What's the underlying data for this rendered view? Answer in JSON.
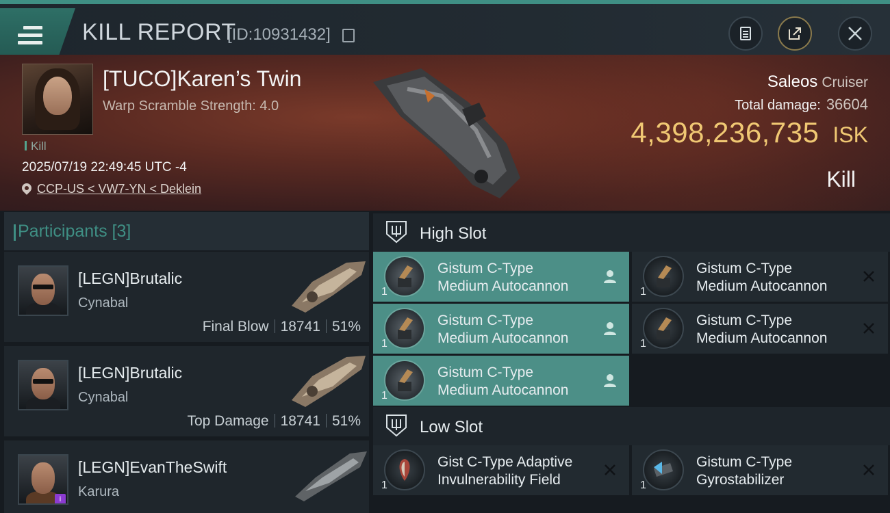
{
  "header": {
    "title": "KILL REPORT",
    "id_text": "[ID:10931432]"
  },
  "victim": {
    "pilot_name": "[TUCO]Karen’s Twin",
    "warp_scramble": "Warp Scramble Strength: 4.0",
    "kill_tag": "Kill",
    "datetime": "2025/07/19 22:49:45 UTC -4",
    "location": "CCP-US < VW7-YN < Deklein",
    "ship_name": "Saleos",
    "ship_class": "Cruiser",
    "total_damage_label": "Total damage:",
    "total_damage": "36604",
    "isk_value": "4,398,236,735",
    "isk_unit": "ISK",
    "result": "Kill"
  },
  "participants": {
    "title": "Participants [3]",
    "items": [
      {
        "name": "[LEGN]Brutalic",
        "ship": "Cynabal",
        "role": "Final Blow",
        "damage": "18741",
        "percent": "51%"
      },
      {
        "name": "[LEGN]Brutalic",
        "ship": "Cynabal",
        "role": "Top Damage",
        "damage": "18741",
        "percent": "51%"
      },
      {
        "name": "[LEGN]EvanTheSwift",
        "ship": "Karura",
        "badge": "i"
      }
    ]
  },
  "high_slot": {
    "title": "High Slot",
    "modules": [
      {
        "line1": "Gistum C-Type",
        "line2": "Medium Autocannon",
        "qty": "1",
        "state": "dropped"
      },
      {
        "line1": "Gistum C-Type",
        "line2": "Medium Autocannon",
        "qty": "1",
        "state": "destroyed"
      },
      {
        "line1": "Gistum C-Type",
        "line2": "Medium Autocannon",
        "qty": "1",
        "state": "dropped"
      },
      {
        "line1": "Gistum C-Type",
        "line2": "Medium Autocannon",
        "qty": "1",
        "state": "destroyed"
      },
      {
        "line1": "Gistum C-Type",
        "line2": "Medium Autocannon",
        "qty": "1",
        "state": "dropped"
      }
    ]
  },
  "low_slot": {
    "title": "Low Slot",
    "modules": [
      {
        "line1": "Gist C-Type Adaptive",
        "line2": "Invulnerability Field",
        "qty": "1",
        "state": "destroyed"
      },
      {
        "line1": "Gistum C-Type",
        "line2": "Gyrostabilizer",
        "qty": "1",
        "state": "destroyed"
      }
    ]
  },
  "icons": {
    "menu": "hamburger-menu-icon",
    "copy": "copy-icon",
    "clipboard": "clipboard-icon",
    "share": "share-icon",
    "close": "close-icon",
    "pin": "location-pin-icon",
    "dropped": "person-icon",
    "destroyed": "x-icon"
  },
  "colors": {
    "accent": "#3f8f84",
    "isk": "#f0c873",
    "active_module": "#4c8f87"
  }
}
